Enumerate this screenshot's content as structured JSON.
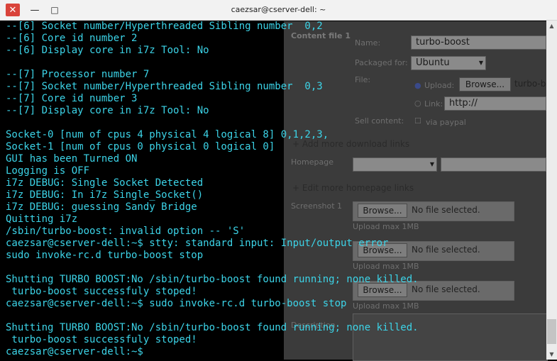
{
  "window": {
    "title": "caezsar@cserver-dell: ~",
    "close_glyph": "✕",
    "minimize_glyph": "—",
    "maximize_glyph": "□"
  },
  "background_page": {
    "heading": "Content file 1",
    "name_label": "Name:",
    "name_value": "turbo-boost",
    "packaged_label": "Packaged for:",
    "packaged_value": "Ubuntu",
    "file_label": "File:",
    "upload_label": "Upload:",
    "browse_label": "Browse...",
    "upload_value": "turbo-b",
    "link_label": "Link:",
    "link_value": "http://",
    "sell_label": "Sell content:",
    "via_paypal": "via paypal",
    "add_download": "Add more download links",
    "homepage_label": "Homepage",
    "edit_homepage": "Edit more homepage links",
    "screenshot_label": "Screenshot 1",
    "no_file": "No file selected.",
    "upload_max": "Upload max 1MB",
    "description_label": "Description"
  },
  "terminal": {
    "lines": [
      "--[6] Socket number/Hyperthreaded Sibling number  0,2",
      "--[6] Core id number 2",
      "--[6] Display core in i7z Tool: No",
      "",
      "--[7] Processor number 7",
      "--[7] Socket number/Hyperthreaded Sibling number  0,3",
      "--[7] Core id number 3",
      "--[7] Display core in i7z Tool: No",
      "",
      "Socket-0 [num of cpus 4 physical 4 logical 8] 0,1,2,3,",
      "Socket-1 [num of cpus 0 physical 0 logical 0]",
      "GUI has been Turned ON",
      "Logging is OFF",
      "i7z DEBUG: Single Socket Detected",
      "i7z DEBUG: In i7z Single_Socket()",
      "i7z DEBUG: guessing Sandy Bridge",
      "Quitting i7z",
      "/sbin/turbo-boost: invalid option -- 'S'",
      "caezsar@cserver-dell:~$ stty: standard input: Input/output error",
      "sudo invoke-rc.d turbo-boost stop",
      "",
      "Shutting TURBO BOOST:No /sbin/turbo-boost found running; none killed.",
      " turbo-boost successfuly stoped!",
      "caezsar@cserver-dell:~$ sudo invoke-rc.d turbo-boost stop",
      "",
      "Shutting TURBO BOOST:No /sbin/turbo-boost found running; none killed.",
      " turbo-boost successfuly stoped!",
      "caezsar@cserver-dell:~$ "
    ]
  },
  "scrollbar": {
    "up_glyph": "▲",
    "down_glyph": "▼"
  },
  "colors": {
    "terminal_text": "#3cd4e8",
    "terminal_bg": "#000000",
    "close_button": "#d9433a"
  }
}
